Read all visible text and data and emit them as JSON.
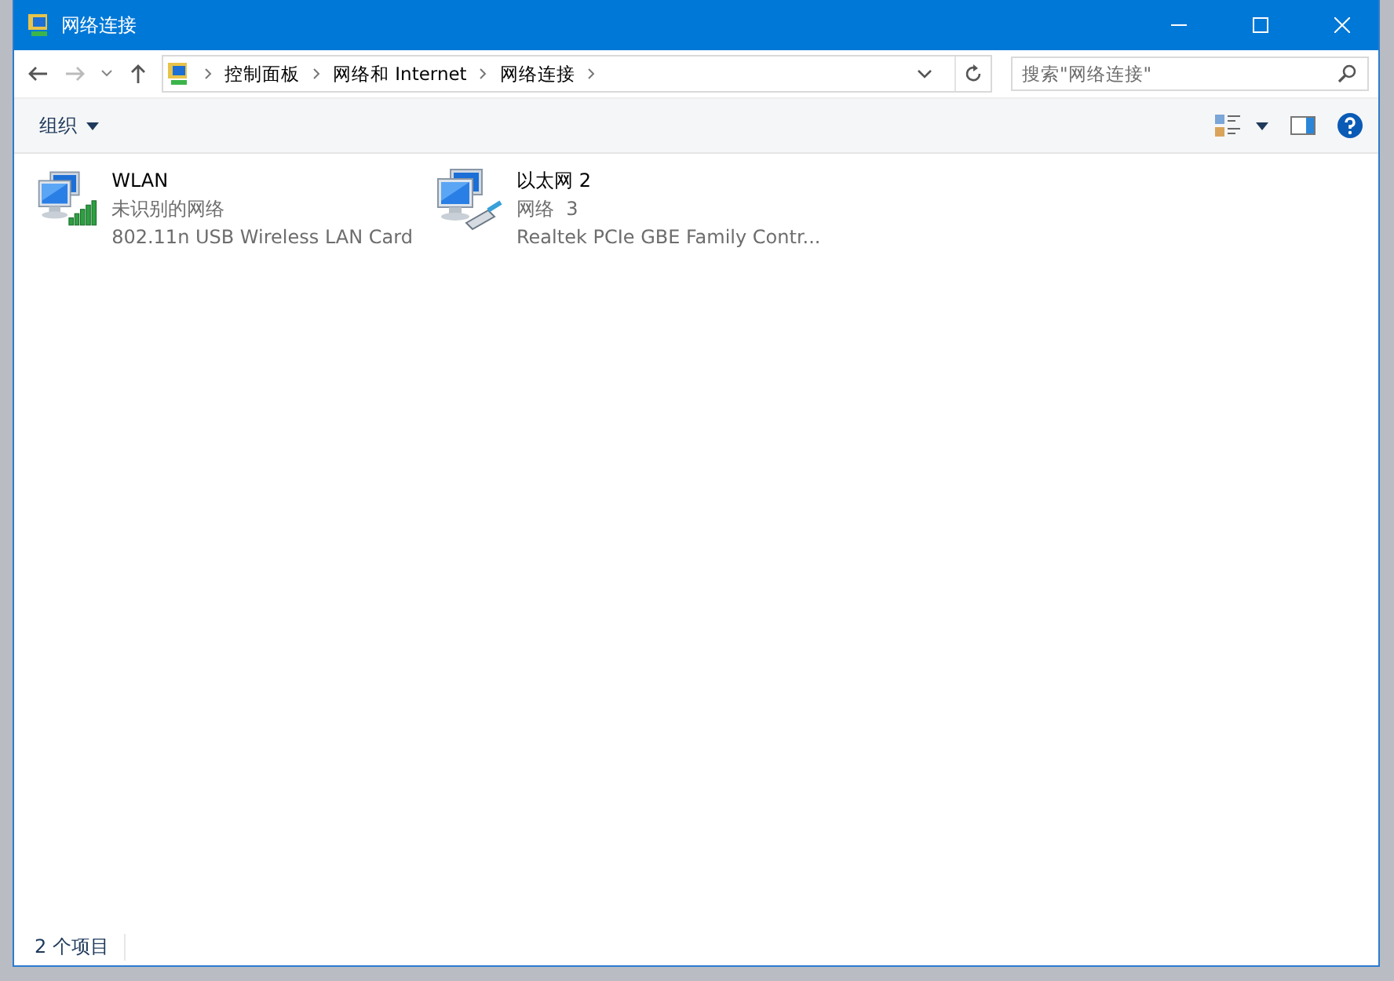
{
  "window": {
    "title": "网络连接"
  },
  "address_bar": {
    "crumbs": [
      "控制面板",
      "网络和 Internet",
      "网络连接"
    ]
  },
  "search": {
    "placeholder": "搜索\"网络连接\""
  },
  "toolbar": {
    "organize": "组织"
  },
  "connections": [
    {
      "kind": "wifi",
      "name": "WLAN",
      "status": "未识别的网络",
      "device": "802.11n USB Wireless LAN Card"
    },
    {
      "kind": "ethernet",
      "name": "以太网 2",
      "status": "网络  3",
      "device": "Realtek PCIe GBE Family Contr..."
    }
  ],
  "status_bar": {
    "count": "2 个项目"
  }
}
